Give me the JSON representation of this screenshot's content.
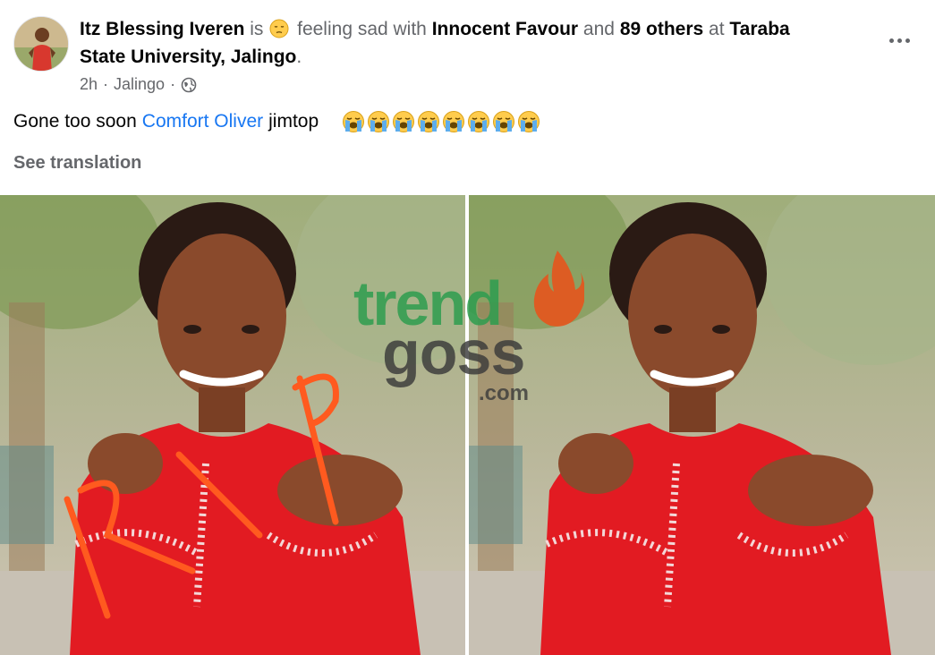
{
  "post": {
    "author": "Itz Blessing Iveren",
    "is_word": "is",
    "feeling_emoji": "pensive-face-icon",
    "feeling_text": "feeling sad with",
    "tagged_person": "Innocent Favour",
    "and_word": "and",
    "others": "89 others",
    "at_word": "at",
    "location_line1": "Taraba",
    "location_line2": "State University, Jalingo",
    "location_end": ".",
    "time": "2h",
    "place": "Jalingo",
    "separator": "·",
    "privacy_icon": "globe-icon",
    "more_icon": "more-options-icon"
  },
  "body": {
    "text_before": "Gone too soon",
    "mention": "Comfort Oliver",
    "text_after": "jimtop",
    "emoji": "loudly-crying-face-icon",
    "emoji_count": 8,
    "see_translation": "See translation"
  },
  "photos": {
    "count": 2,
    "overlay_handwriting": "RIP",
    "watermark_word1": "trend",
    "watermark_word2": "goss",
    "watermark_suffix": ".com",
    "colors": {
      "dress_red": "#e21b22",
      "rip_orange": "#ff5a1f",
      "watermark_green": "#2e9d4f",
      "watermark_gray": "#3a3a3a",
      "watermark_flame": "#e8521a"
    }
  },
  "colors": {
    "link_blue": "#1877f2",
    "muted_gray": "#65676b",
    "text": "#050505"
  }
}
